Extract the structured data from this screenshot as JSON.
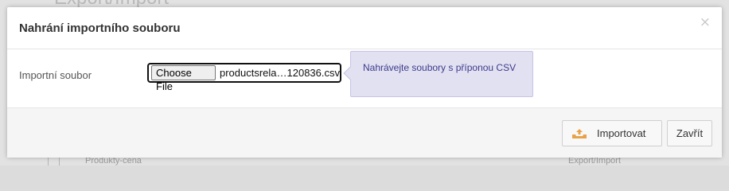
{
  "background": {
    "title": "Export/Import",
    "row_left": "Produkty-cena",
    "row_right": "Export/Import"
  },
  "modal": {
    "title": "Nahrání importního souboru",
    "close_symbol": "×",
    "field_label": "Importní soubor",
    "file_input": {
      "button_label": "Choose File",
      "file_name": "productsrela…120836.csv"
    },
    "tooltip": "Nahrávejte soubory s příponou CSV",
    "footer": {
      "import_label": "Importovat",
      "import_icon": "upload-tray-icon",
      "close_label": "Zavřít"
    }
  },
  "colors": {
    "tooltip_bg": "#e2e1f2",
    "tooltip_text": "#3d3a8a",
    "import_icon": "#e8a34a"
  }
}
